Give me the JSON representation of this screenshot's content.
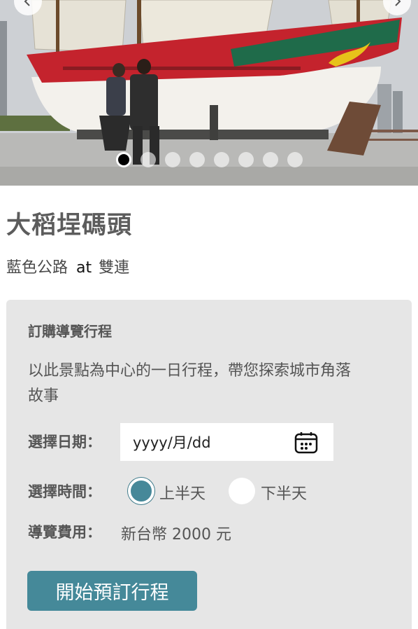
{
  "carousel": {
    "slide_count": 8,
    "active_index": 0,
    "image_subject": "junk-ship-at-pier-photo"
  },
  "attraction": {
    "title": "大稻埕碼頭",
    "route": "藍色公路",
    "at": "at",
    "partner": "雙連"
  },
  "booking": {
    "heading": "訂購導覽行程",
    "description": "以此景點為中心的一日行程，帶您探索城市角落故事",
    "date_label": "選擇日期：",
    "date_placeholder": "yyyy/月/dd",
    "time_label": "選擇時間：",
    "time_options": [
      "上半天",
      "下半天"
    ],
    "time_selected": 0,
    "fee_label": "導覽費用：",
    "fee_value": "新台幣 2000 元",
    "submit_label": "開始預訂行程"
  },
  "colors": {
    "accent": "#458999",
    "card_bg": "#e6e6e6",
    "ship_red": "#c4232d",
    "ship_green": "#1f6b4a"
  }
}
